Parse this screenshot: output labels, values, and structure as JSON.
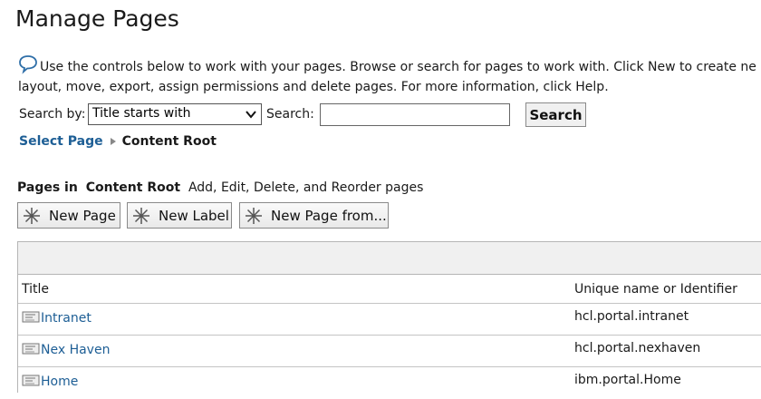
{
  "header": {
    "title": "Manage Pages"
  },
  "intro": {
    "line1": "Use the controls below to work with your pages. Browse or search for pages to work with. Click New to create ne",
    "line2": "layout, move, export, assign permissions and delete pages. For more information, click Help."
  },
  "search": {
    "by_label": "Search by:",
    "selected_option": "Title starts with",
    "search_label": "Search:",
    "input_value": "",
    "button_label": "Search"
  },
  "breadcrumb": {
    "link": "Select Page",
    "current": "Content Root"
  },
  "pages_in": {
    "prefix": "Pages in",
    "location": "Content Root",
    "suffix": "Add, Edit, Delete, and Reorder pages"
  },
  "toolbar": {
    "new_page": "New Page",
    "new_label": "New Label",
    "new_page_from": "New Page from..."
  },
  "table": {
    "headers": {
      "title": "Title",
      "unique_name": "Unique name or Identifier"
    },
    "rows": [
      {
        "title": "Intranet",
        "unique_name": "hcl.portal.intranet"
      },
      {
        "title": "Nex Haven",
        "unique_name": "hcl.portal.nexhaven"
      },
      {
        "title": "Home",
        "unique_name": "ibm.portal.Home"
      }
    ]
  },
  "colors": {
    "link": "#1d5e95",
    "border": "#b5b5b5",
    "toolbar_bg": "#f0f0f0"
  }
}
